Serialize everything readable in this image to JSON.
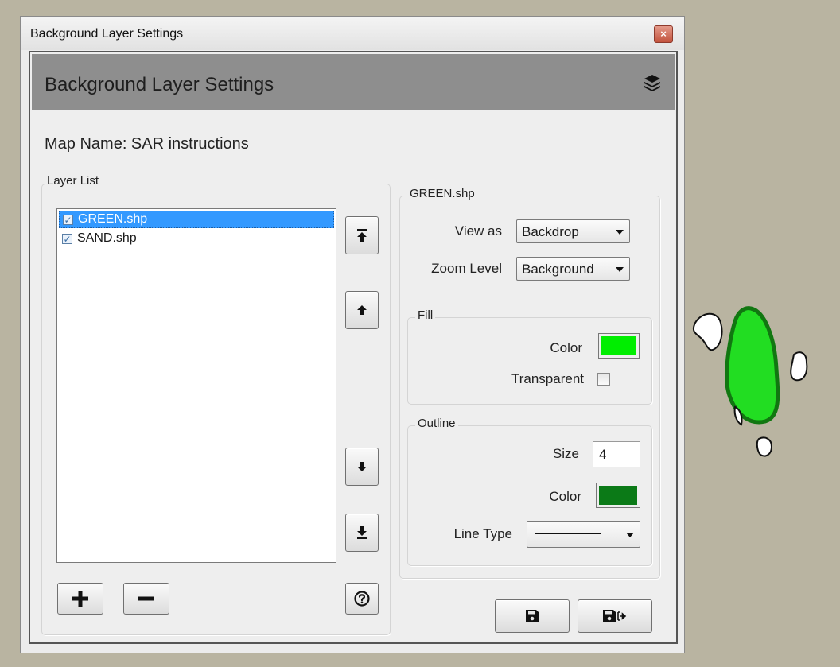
{
  "window": {
    "title": "Background Layer Settings",
    "close_glyph": "×"
  },
  "header": {
    "title": "Background Layer Settings",
    "icon": "layers-icon"
  },
  "map": {
    "label": "Map Name:  SAR instructions"
  },
  "layer_list": {
    "label": "Layer List",
    "items": [
      {
        "name": "GREEN.shp",
        "checked": true,
        "selected": true
      },
      {
        "name": "SAND.shp",
        "checked": true,
        "selected": false
      }
    ]
  },
  "layer_props": {
    "group_label": "GREEN.shp",
    "view_as_label": "View as",
    "view_as_value": "Backdrop",
    "zoom_label": "Zoom Level",
    "zoom_value": "Background",
    "fill": {
      "group_label": "Fill",
      "color_label": "Color",
      "color": "#00ee00",
      "transparent_label": "Transparent",
      "transparent": false
    },
    "outline": {
      "group_label": "Outline",
      "size_label": "Size",
      "size_value": "4",
      "color_label": "Color",
      "color": "#0b7a17",
      "line_type_label": "Line Type"
    }
  },
  "colors": {
    "desktop": "#b9b4a1",
    "header": "#8e8e8e",
    "selection": "#3399ff",
    "map_fill": "#22dd22",
    "map_outline": "#117711"
  }
}
